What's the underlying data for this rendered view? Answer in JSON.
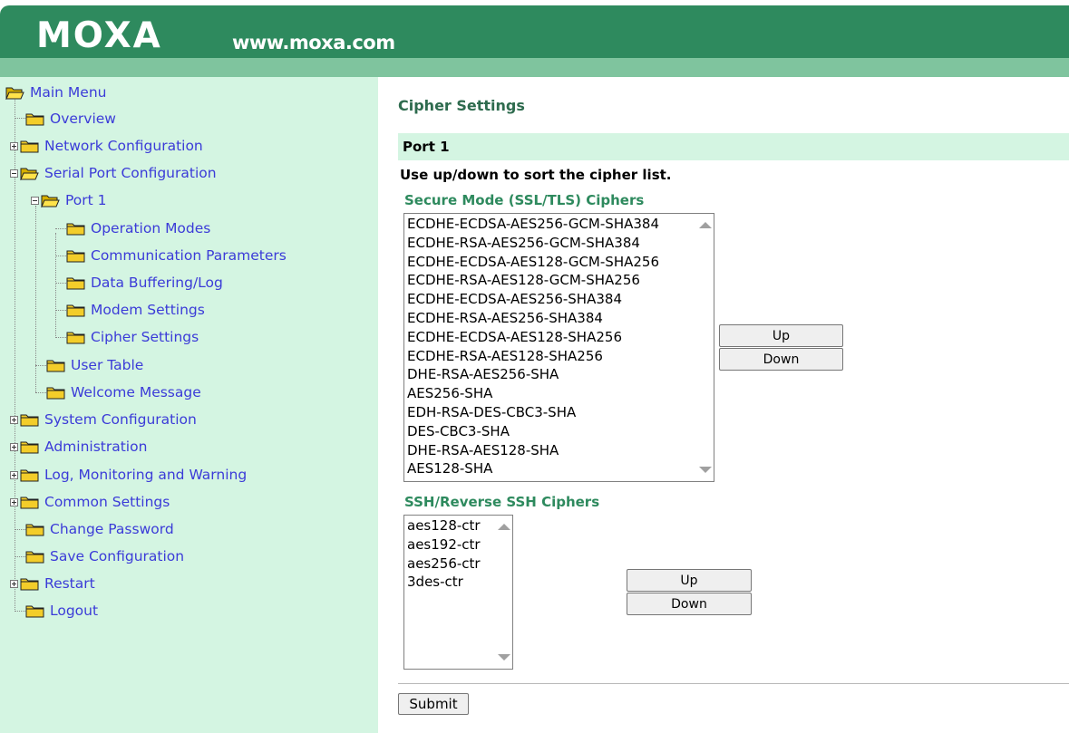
{
  "header": {
    "logo_text": "MOXA",
    "url": "www.moxa.com",
    "colors": {
      "dark": "#2e8a5e",
      "light": "#7fc49e"
    }
  },
  "sidebar": {
    "items": [
      {
        "label": "Main Menu",
        "icon": "open-folder-icon"
      },
      {
        "label": "Overview",
        "icon": "folder-icon"
      },
      {
        "label": "Network Configuration",
        "icon": "folder-icon",
        "expander": "plus"
      },
      {
        "label": "Serial Port Configuration",
        "icon": "open-folder-icon",
        "expander": "minus"
      },
      {
        "label": "Port 1",
        "icon": "open-folder-icon",
        "expander": "minus"
      },
      {
        "label": "Operation Modes",
        "icon": "folder-icon"
      },
      {
        "label": "Communication Parameters",
        "icon": "folder-icon"
      },
      {
        "label": "Data Buffering/Log",
        "icon": "folder-icon"
      },
      {
        "label": "Modem Settings",
        "icon": "folder-icon"
      },
      {
        "label": "Cipher Settings",
        "icon": "folder-icon"
      },
      {
        "label": "User Table",
        "icon": "folder-icon"
      },
      {
        "label": "Welcome Message",
        "icon": "folder-icon"
      },
      {
        "label": "System Configuration",
        "icon": "folder-icon",
        "expander": "plus"
      },
      {
        "label": "Administration",
        "icon": "folder-icon",
        "expander": "plus"
      },
      {
        "label": "Log, Monitoring and Warning",
        "icon": "folder-icon",
        "expander": "plus"
      },
      {
        "label": "Common Settings",
        "icon": "folder-icon",
        "expander": "plus"
      },
      {
        "label": "Change Password",
        "icon": "folder-icon"
      },
      {
        "label": "Save Configuration",
        "icon": "folder-icon"
      },
      {
        "label": "Restart",
        "icon": "folder-icon",
        "expander": "plus"
      },
      {
        "label": "Logout",
        "icon": "folder-icon"
      }
    ]
  },
  "main": {
    "title": "Cipher Settings",
    "port_title": "Port 1",
    "instructions": "Use up/down to sort the cipher list.",
    "ssl": {
      "label": "Secure Mode (SSL/TLS) Ciphers",
      "options": [
        "ECDHE-ECDSA-AES256-GCM-SHA384",
        "ECDHE-RSA-AES256-GCM-SHA384",
        "ECDHE-ECDSA-AES128-GCM-SHA256",
        "ECDHE-RSA-AES128-GCM-SHA256",
        "ECDHE-ECDSA-AES256-SHA384",
        "ECDHE-RSA-AES256-SHA384",
        "ECDHE-ECDSA-AES128-SHA256",
        "ECDHE-RSA-AES128-SHA256",
        "DHE-RSA-AES256-SHA",
        "AES256-SHA",
        "EDH-RSA-DES-CBC3-SHA",
        "DES-CBC3-SHA",
        "DHE-RSA-AES128-SHA",
        "AES128-SHA"
      ],
      "up_label": "Up",
      "down_label": "Down"
    },
    "ssh": {
      "label": "SSH/Reverse SSH Ciphers",
      "options": [
        "aes128-ctr",
        "aes192-ctr",
        "aes256-ctr",
        "3des-ctr"
      ],
      "up_label": "Up",
      "down_label": "Down"
    },
    "submit_label": "Submit"
  }
}
